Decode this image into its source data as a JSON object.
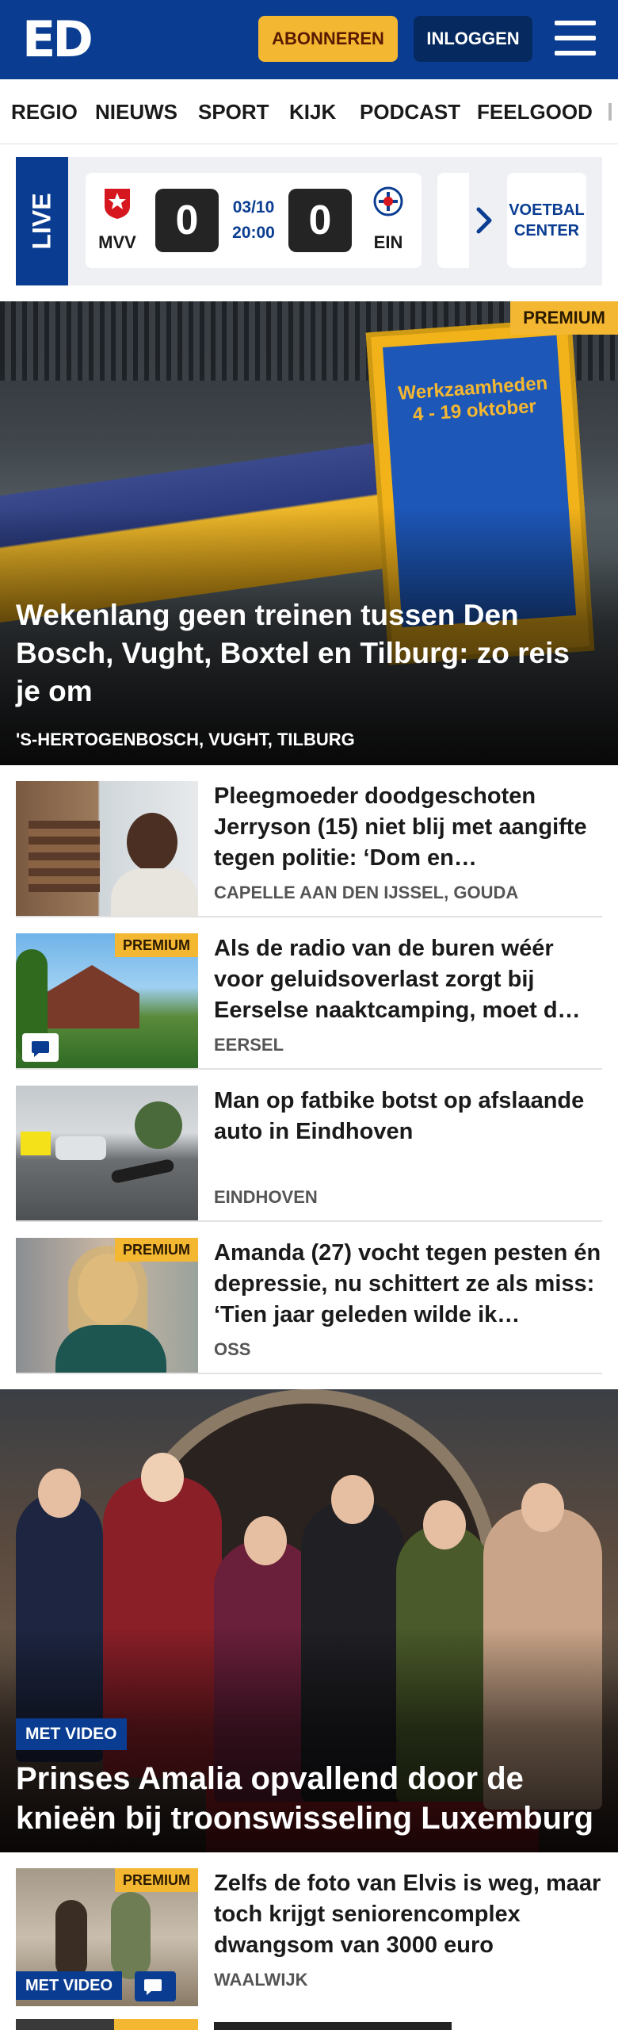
{
  "header": {
    "logo": "ED",
    "subscribe_label": "ABONNEREN",
    "login_label": "INLOGGEN",
    "brand_color": "#0a3d91",
    "accent_color": "#f4b731"
  },
  "nav": {
    "items": [
      "REGIO",
      "NIEUWS",
      "SPORT",
      "KIJK",
      "PODCAST",
      "FEELGOOD"
    ]
  },
  "live": {
    "label": "LIVE",
    "match": {
      "home_code": "MVV",
      "home_score": "0",
      "date": "03/10",
      "time": "20:00",
      "away_score": "0",
      "away_code": "EIN"
    },
    "category_line1": "VOETBAL",
    "category_line2": "CENTER"
  },
  "hero1": {
    "badge": "PREMIUM",
    "title": "Wekenlang geen treinen tussen Den Bosch, Vught, Boxtel en Tilburg: zo reis je om",
    "location": "'S-HERTOGENBOSCH, VUGHT, TILBURG",
    "sign_title": "Werkzaamheden 4 - 19 oktober"
  },
  "articles": [
    {
      "title": "Pleegmoeder doodgeschoten Jerryson (15) niet blij met aangifte tegen politie: ‘Dom en…",
      "location": "CAPELLE AAN DEN IJSSEL, GOUDA",
      "premium": ""
    },
    {
      "title": "Als de radio van de buren wéér voor geluidsoverlast zorgt bij Eerselse naaktcamping, moet d…",
      "location": "EERSEL",
      "premium": "PREMIUM"
    },
    {
      "title": "Man op fatbike botst op afslaande auto in Eindhoven",
      "location": "EINDHOVEN",
      "premium": ""
    },
    {
      "title": "Amanda (27) vocht tegen pesten én depressie, nu schittert ze als miss: ‘Tien jaar geleden wilde ik…",
      "location": "OSS",
      "premium": "PREMIUM"
    }
  ],
  "hero2": {
    "badge": "MET VIDEO",
    "title": "Prinses Amalia opvallend door de knieën bij troonswisseling Luxemburg"
  },
  "article5": {
    "premium": "PREMIUM",
    "video": "MET VIDEO",
    "title": "Zelfs de foto van Elvis is weg, maar toch krijgt seniorencom­plex dwangsom van 3000 euro",
    "location": "WAALWIJK"
  },
  "icons": [
    "menu-icon",
    "mvv-crest-icon",
    "psv-crest-icon",
    "chevron-right-icon",
    "comment-icon"
  ]
}
